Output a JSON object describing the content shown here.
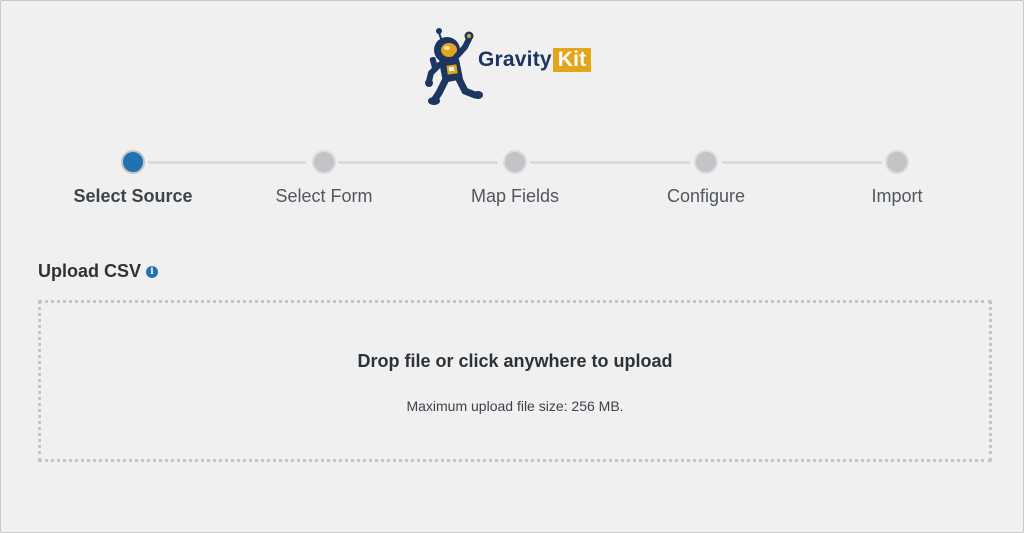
{
  "logo": {
    "word1": "Gravity",
    "word2": "Kit"
  },
  "steps": [
    {
      "label": "Select Source",
      "active": true
    },
    {
      "label": "Select Form",
      "active": false
    },
    {
      "label": "Map Fields",
      "active": false
    },
    {
      "label": "Configure",
      "active": false
    },
    {
      "label": "Import",
      "active": false
    }
  ],
  "upload": {
    "title": "Upload CSV",
    "info_icon": "info-icon",
    "drop_title": "Drop file or click anywhere to upload",
    "drop_subtitle": "Maximum upload file size: 256 MB."
  },
  "colors": {
    "accent": "#2271b1",
    "brand_navy": "#1d3561",
    "brand_gold": "#e3a51a",
    "background": "#f0f0f1"
  }
}
